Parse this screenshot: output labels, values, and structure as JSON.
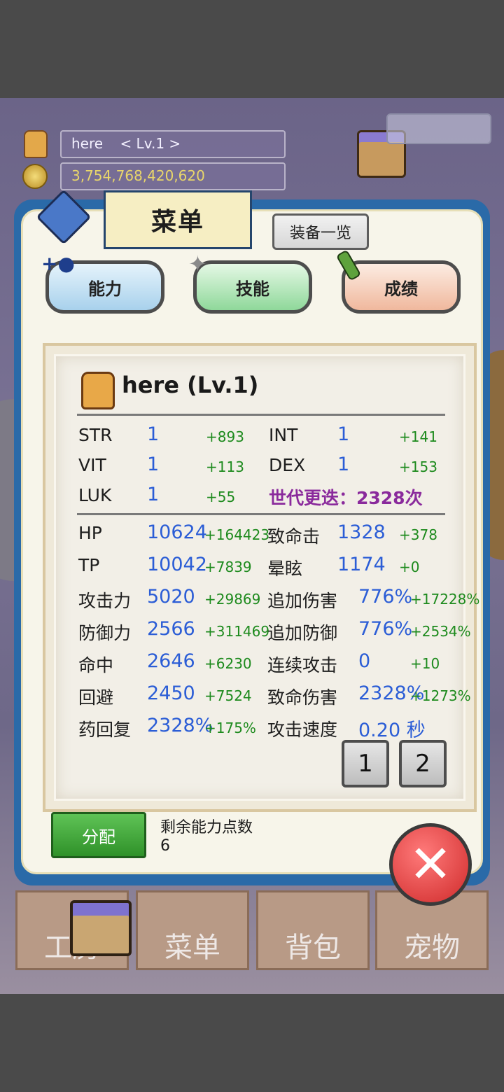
{
  "hud": {
    "player_name": "here",
    "player_level": "< Lv.1 >",
    "gold": "3,754,768,420,620"
  },
  "menu": {
    "title": "菜单",
    "equipment_list_label": "装备一览",
    "categories": [
      {
        "label": "能力",
        "color": "#cfe6f5"
      },
      {
        "label": "技能",
        "color": "#c9f2cf"
      },
      {
        "label": "成绩",
        "color": "#f7d9c8"
      }
    ]
  },
  "stats": {
    "header": "here (Lv.1)",
    "base": [
      {
        "label": "STR",
        "value": "1",
        "bonus": "+893"
      },
      {
        "label": "INT",
        "value": "1",
        "bonus": "+141"
      },
      {
        "label": "VIT",
        "value": "1",
        "bonus": "+113"
      },
      {
        "label": "DEX",
        "value": "1",
        "bonus": "+153"
      },
      {
        "label": "LUK",
        "value": "1",
        "bonus": "+55"
      }
    ],
    "generation": "世代更迭：2328次",
    "combat": [
      {
        "label": "HP",
        "value": "10624",
        "bonus": "+164423"
      },
      {
        "label": "致命击",
        "value": "1328",
        "bonus": "+378"
      },
      {
        "label": "TP",
        "value": "10042",
        "bonus": "+7839"
      },
      {
        "label": "晕眩",
        "value": "1174",
        "bonus": "+0"
      },
      {
        "label": "攻击力",
        "value": "5020",
        "bonus": "+29869"
      },
      {
        "label": "追加伤害",
        "value": "776%",
        "bonus": "+17228%"
      },
      {
        "label": "防御力",
        "value": "2566",
        "bonus": "+311469"
      },
      {
        "label": "追加防御",
        "value": "776%",
        "bonus": "+2534%"
      },
      {
        "label": "命中",
        "value": "2646",
        "bonus": "+6230"
      },
      {
        "label": "连续攻击",
        "value": "0",
        "bonus": "+10"
      },
      {
        "label": "回避",
        "value": "2450",
        "bonus": "+7524"
      },
      {
        "label": "致命伤害",
        "value": "2328%",
        "bonus": "+1273%"
      },
      {
        "label": "药回复",
        "value": "2328%",
        "bonus": "+175%"
      },
      {
        "label": "攻击速度",
        "value": "0.20 秒",
        "bonus": ""
      }
    ],
    "pages": [
      "1",
      "2"
    ]
  },
  "allocate": {
    "button_label": "分配",
    "remaining_label": "剩余能力点数",
    "remaining_value": "6"
  },
  "bottom_nav": [
    {
      "label": "工房"
    },
    {
      "label": "菜单"
    },
    {
      "label": "背包"
    },
    {
      "label": "宠物"
    }
  ],
  "colors": {
    "panel_border": "#2a6aa8",
    "stat_value": "#2b5dd6",
    "stat_bonus": "#1d8a1d",
    "generation": "#8a2a9c",
    "allocate_button": "#3ea33a",
    "close_button": "#d93a3a"
  }
}
